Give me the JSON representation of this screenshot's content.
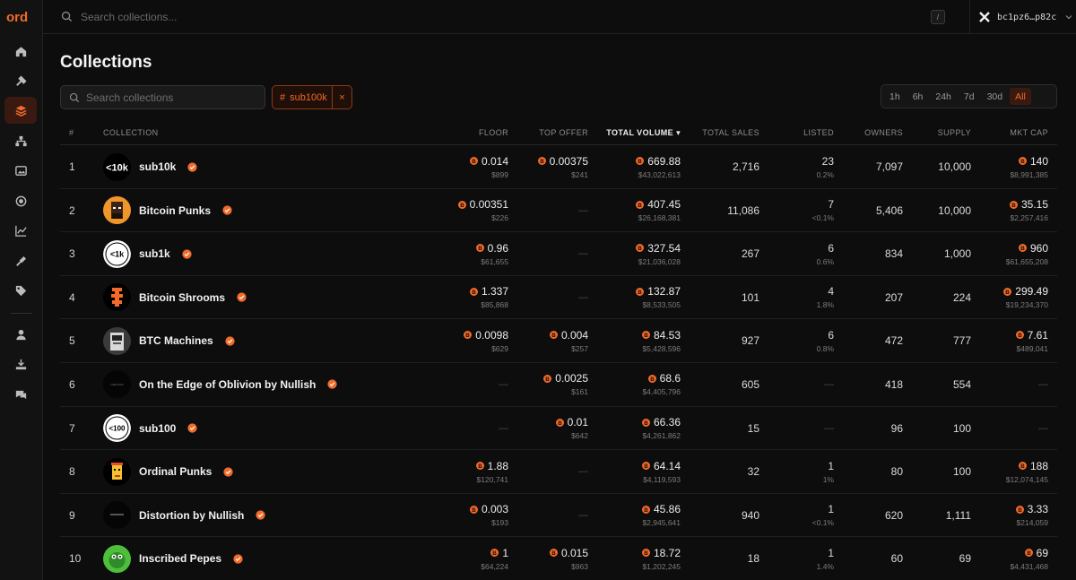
{
  "app": {
    "logo": "ord"
  },
  "topbar": {
    "search_placeholder": "Search collections...",
    "shortcut": "/",
    "wallet_address": "bc1pz6…p82c"
  },
  "page": {
    "title": "Collections"
  },
  "filters": {
    "search_placeholder": "Search collections",
    "chip_label": "sub100k",
    "chip_close": "×",
    "periods": [
      "1h",
      "6h",
      "24h",
      "7d",
      "30d",
      "All"
    ],
    "active_period": "All"
  },
  "table": {
    "headers": {
      "rank": "#",
      "collection": "COLLECTION",
      "floor": "FLOOR",
      "top_offer": "TOP OFFER",
      "total_volume": "TOTAL VOLUME",
      "total_sales": "TOTAL SALES",
      "listed": "LISTED",
      "owners": "OWNERS",
      "supply": "SUPPLY",
      "mkt_cap": "MKT CAP"
    },
    "sort_indicator": "▾",
    "empty": "—",
    "rows": [
      {
        "rank": "1",
        "name": "sub10k",
        "floor": "0.014",
        "floor_usd": "$899",
        "offer": "0.00375",
        "offer_usd": "$241",
        "volume": "669.88",
        "volume_usd": "$43,022,613",
        "sales": "2,716",
        "listed": "23",
        "listed_pct": "0.2%",
        "owners": "7,097",
        "supply": "10,000",
        "mcap": "140",
        "mcap_usd": "$8,991,385",
        "avatar": "sub10k",
        "avatar_text": "<10k"
      },
      {
        "rank": "2",
        "name": "Bitcoin Punks",
        "floor": "0.00351",
        "floor_usd": "$226",
        "offer": "",
        "offer_usd": "",
        "volume": "407.45",
        "volume_usd": "$26,168,381",
        "sales": "11,086",
        "listed": "7",
        "listed_pct": "<0.1%",
        "owners": "5,406",
        "supply": "10,000",
        "mcap": "35.15",
        "mcap_usd": "$2,257,416",
        "avatar": "punk",
        "avatar_text": ""
      },
      {
        "rank": "3",
        "name": "sub1k",
        "floor": "0.96",
        "floor_usd": "$61,655",
        "offer": "",
        "offer_usd": "",
        "volume": "327.54",
        "volume_usd": "$21,036,028",
        "sales": "267",
        "listed": "6",
        "listed_pct": "0.6%",
        "owners": "834",
        "supply": "1,000",
        "mcap": "960",
        "mcap_usd": "$61,655,208",
        "avatar": "sub1k",
        "avatar_text": "<1k"
      },
      {
        "rank": "4",
        "name": "Bitcoin Shrooms",
        "floor": "1.337",
        "floor_usd": "$85,868",
        "offer": "",
        "offer_usd": "",
        "volume": "132.87",
        "volume_usd": "$8,533,505",
        "sales": "101",
        "listed": "4",
        "listed_pct": "1.8%",
        "owners": "207",
        "supply": "224",
        "mcap": "299.49",
        "mcap_usd": "$19,234,370",
        "avatar": "shroom",
        "avatar_text": ""
      },
      {
        "rank": "5",
        "name": "BTC Machines",
        "floor": "0.0098",
        "floor_usd": "$629",
        "offer": "0.004",
        "offer_usd": "$257",
        "volume": "84.53",
        "volume_usd": "$5,428,596",
        "sales": "927",
        "listed": "6",
        "listed_pct": "0.8%",
        "owners": "472",
        "supply": "777",
        "mcap": "7.61",
        "mcap_usd": "$489,041",
        "avatar": "machine",
        "avatar_text": ""
      },
      {
        "rank": "6",
        "name": "On the Edge of Oblivion by Nullish",
        "floor": "",
        "floor_usd": "",
        "offer": "0.0025",
        "offer_usd": "$161",
        "volume": "68.6",
        "volume_usd": "$4,405,796",
        "sales": "605",
        "listed": "",
        "listed_pct": "",
        "owners": "418",
        "supply": "554",
        "mcap": "",
        "mcap_usd": "",
        "avatar": "dark",
        "avatar_text": ""
      },
      {
        "rank": "7",
        "name": "sub100",
        "floor": "",
        "floor_usd": "",
        "offer": "0.01",
        "offer_usd": "$642",
        "volume": "66.36",
        "volume_usd": "$4,261,862",
        "sales": "15",
        "listed": "",
        "listed_pct": "",
        "owners": "96",
        "supply": "100",
        "mcap": "",
        "mcap_usd": "",
        "avatar": "sub100",
        "avatar_text": "<100"
      },
      {
        "rank": "8",
        "name": "Ordinal Punks",
        "floor": "1.88",
        "floor_usd": "$120,741",
        "offer": "",
        "offer_usd": "",
        "volume": "64.14",
        "volume_usd": "$4,119,593",
        "sales": "32",
        "listed": "1",
        "listed_pct": "1%",
        "owners": "80",
        "supply": "100",
        "mcap": "188",
        "mcap_usd": "$12,074,145",
        "avatar": "opunk",
        "avatar_text": ""
      },
      {
        "rank": "9",
        "name": "Distortion by Nullish",
        "floor": "0.003",
        "floor_usd": "$193",
        "offer": "",
        "offer_usd": "",
        "volume": "45.86",
        "volume_usd": "$2,945,641",
        "sales": "940",
        "listed": "1",
        "listed_pct": "<0.1%",
        "owners": "620",
        "supply": "1,111",
        "mcap": "3.33",
        "mcap_usd": "$214,059",
        "avatar": "dark2",
        "avatar_text": ""
      },
      {
        "rank": "10",
        "name": "Inscribed Pepes",
        "floor": "1",
        "floor_usd": "$64,224",
        "offer": "0.015",
        "offer_usd": "$963",
        "volume": "18.72",
        "volume_usd": "$1,202,245",
        "sales": "18",
        "listed": "1",
        "listed_pct": "1.4%",
        "owners": "60",
        "supply": "69",
        "mcap": "69",
        "mcap_usd": "$4,431,468",
        "avatar": "pepe",
        "avatar_text": ""
      }
    ]
  },
  "colors": {
    "accent": "#f26b2a",
    "background": "#0d0d0d",
    "sidebar": "#121212"
  }
}
